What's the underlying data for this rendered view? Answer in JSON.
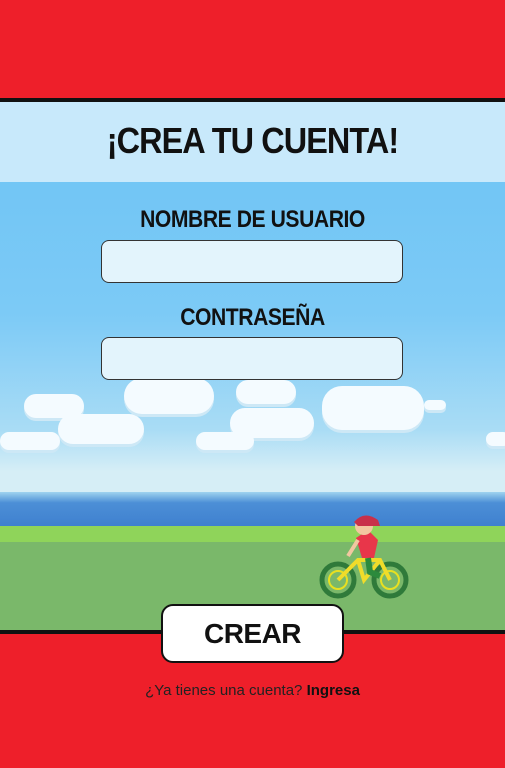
{
  "header": {
    "title": "¡CREA TU CUENTA!"
  },
  "form": {
    "username_label": "NOMBRE DE USUARIO",
    "username_value": "",
    "password_label": "CONTRASEÑA",
    "password_value": ""
  },
  "actions": {
    "create_label": "CREAR"
  },
  "footer": {
    "prompt": "¿Ya tienes una cuenta?",
    "login_link": "Ingresa"
  },
  "colors": {
    "brand_red": "#ee1f2a",
    "title_band": "#c8e9fb",
    "field_bg": "#e3f4fc",
    "sky": "#6cc3f4"
  },
  "decor": {
    "scene_image": "pixel-art-cyclist-on-coastal-road"
  }
}
